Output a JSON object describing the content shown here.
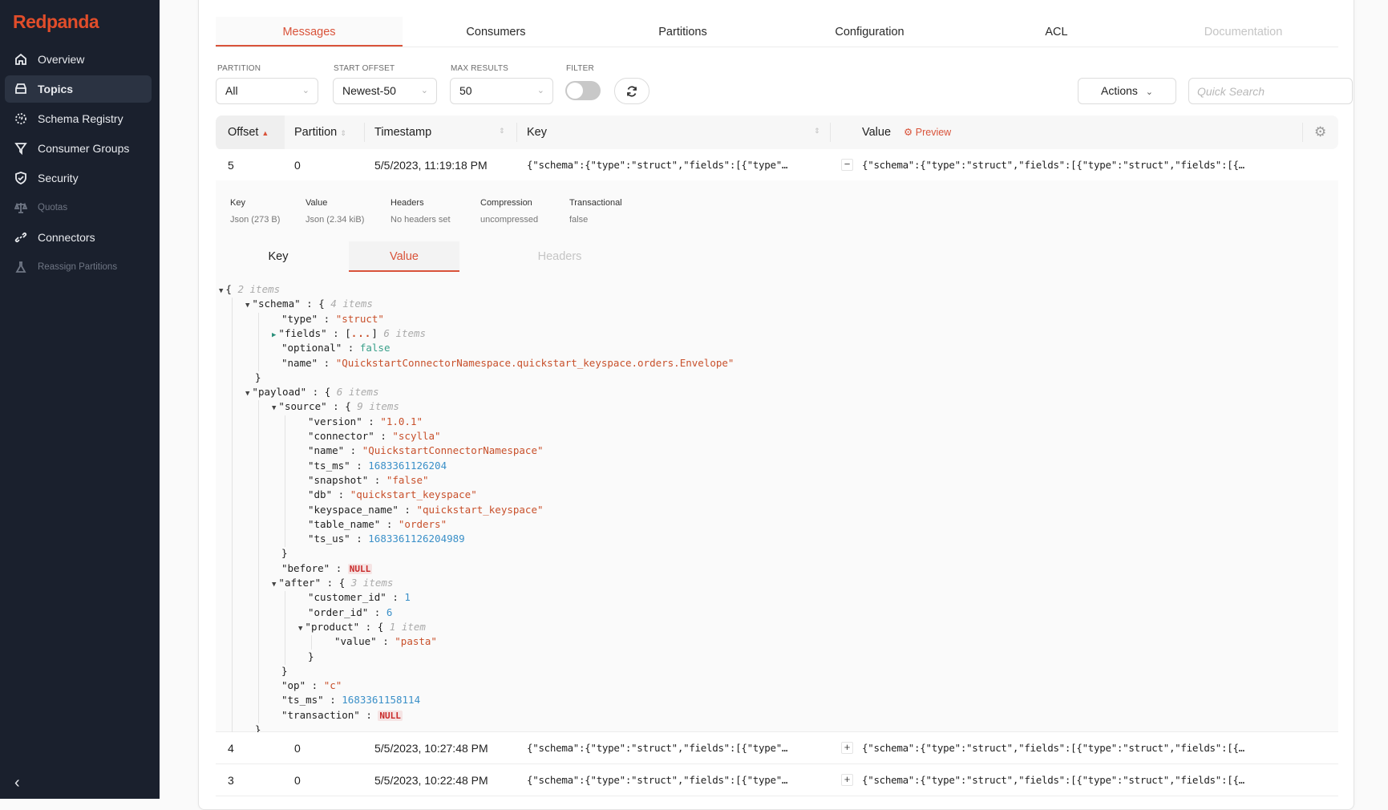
{
  "app": {
    "brand": "Redpanda"
  },
  "sidebar": {
    "items": [
      {
        "label": "Overview",
        "icon": "home-icon",
        "state": "normal"
      },
      {
        "label": "Topics",
        "icon": "topics-icon",
        "state": "active"
      },
      {
        "label": "Schema Registry",
        "icon": "schema-registry-icon",
        "state": "normal"
      },
      {
        "label": "Consumer Groups",
        "icon": "filter-funnel-icon",
        "state": "normal"
      },
      {
        "label": "Security",
        "icon": "shield-icon",
        "state": "normal"
      },
      {
        "label": "Quotas",
        "icon": "scale-icon",
        "state": "disabled"
      },
      {
        "label": "Connectors",
        "icon": "link-icon",
        "state": "normal"
      },
      {
        "label": "Reassign Partitions",
        "icon": "flask-icon",
        "state": "disabled"
      }
    ],
    "collapse_icon": "chevron-left-icon"
  },
  "tabs": [
    {
      "label": "Messages",
      "state": "active"
    },
    {
      "label": "Consumers",
      "state": "normal"
    },
    {
      "label": "Partitions",
      "state": "normal"
    },
    {
      "label": "Configuration",
      "state": "normal"
    },
    {
      "label": "ACL",
      "state": "normal"
    },
    {
      "label": "Documentation",
      "state": "disabled"
    }
  ],
  "filters": {
    "partition": {
      "label": "PARTITION",
      "value": "All"
    },
    "start_offset": {
      "label": "START OFFSET",
      "value": "Newest-50"
    },
    "max_results": {
      "label": "MAX RESULTS",
      "value": "50"
    },
    "filter": {
      "label": "FILTER",
      "enabled": false
    },
    "refresh_icon": "refresh-icon"
  },
  "actions": {
    "label": "Actions"
  },
  "search": {
    "placeholder": "Quick Search",
    "value": ""
  },
  "table": {
    "columns": {
      "offset": "Offset",
      "partition": "Partition",
      "timestamp": "Timestamp",
      "key": "Key",
      "value": "Value",
      "preview": "Preview"
    },
    "rows": [
      {
        "offset": "5",
        "partition": "0",
        "timestamp": "5/5/2023, 11:19:18 PM",
        "key": "{\"schema\":{\"type\":\"struct\",\"fields\":[{\"type\"…",
        "toggle": "−",
        "value": "{\"schema\":{\"type\":\"struct\",\"fields\":[{\"type\":\"struct\",\"fields\":[{…",
        "expanded": true
      },
      {
        "offset": "4",
        "partition": "0",
        "timestamp": "5/5/2023, 10:27:48 PM",
        "key": "{\"schema\":{\"type\":\"struct\",\"fields\":[{\"type\"…",
        "toggle": "+",
        "value": "{\"schema\":{\"type\":\"struct\",\"fields\":[{\"type\":\"struct\",\"fields\":[{…",
        "expanded": false
      },
      {
        "offset": "3",
        "partition": "0",
        "timestamp": "5/5/2023, 10:22:48 PM",
        "key": "{\"schema\":{\"type\":\"struct\",\"fields\":[{\"type\"…",
        "toggle": "+",
        "value": "{\"schema\":{\"type\":\"struct\",\"fields\":[{\"type\":\"struct\",\"fields\":[{…",
        "expanded": false
      }
    ]
  },
  "detail": {
    "meta": [
      {
        "label": "Key",
        "value": "Json (273 B)"
      },
      {
        "label": "Value",
        "value": "Json (2.34 kiB)"
      },
      {
        "label": "Headers",
        "value": "No headers set"
      },
      {
        "label": "Compression",
        "value": "uncompressed"
      },
      {
        "label": "Transactional",
        "value": "false"
      }
    ],
    "subtabs": [
      {
        "label": "Key",
        "state": "normal"
      },
      {
        "label": "Value",
        "state": "active"
      },
      {
        "label": "Headers",
        "state": "disabled"
      }
    ],
    "json_lines": [
      {
        "indent": 0,
        "toggle": "down",
        "key": "",
        "open": "{",
        "count": "2 items"
      },
      {
        "indent": 1,
        "toggle": "down",
        "key": "\"schema\"",
        "open": "{",
        "count": "4 items"
      },
      {
        "indent": 2,
        "key": "\"type\"",
        "value": "\"struct\"",
        "type": "s"
      },
      {
        "indent": 2,
        "toggle": "right",
        "key": "\"fields\"",
        "collapsed": "[...]",
        "count": "6 items"
      },
      {
        "indent": 2,
        "key": "\"optional\"",
        "value": "false",
        "type": "b"
      },
      {
        "indent": 2,
        "key": "\"name\"",
        "value": "\"QuickstartConnectorNamespace.quickstart_keyspace.orders.Envelope\"",
        "type": "s"
      },
      {
        "indent": 1,
        "close": "}"
      },
      {
        "indent": 1,
        "toggle": "down",
        "key": "\"payload\"",
        "open": "{",
        "count": "6 items"
      },
      {
        "indent": 2,
        "toggle": "down",
        "key": "\"source\"",
        "open": "{",
        "count": "9 items"
      },
      {
        "indent": 3,
        "key": "\"version\"",
        "value": "\"1.0.1\"",
        "type": "s"
      },
      {
        "indent": 3,
        "key": "\"connector\"",
        "value": "\"scylla\"",
        "type": "s"
      },
      {
        "indent": 3,
        "key": "\"name\"",
        "value": "\"QuickstartConnectorNamespace\"",
        "type": "s"
      },
      {
        "indent": 3,
        "key": "\"ts_ms\"",
        "value": "1683361126204",
        "type": "n"
      },
      {
        "indent": 3,
        "key": "\"snapshot\"",
        "value": "\"false\"",
        "type": "s"
      },
      {
        "indent": 3,
        "key": "\"db\"",
        "value": "\"quickstart_keyspace\"",
        "type": "s"
      },
      {
        "indent": 3,
        "key": "\"keyspace_name\"",
        "value": "\"quickstart_keyspace\"",
        "type": "s"
      },
      {
        "indent": 3,
        "key": "\"table_name\"",
        "value": "\"orders\"",
        "type": "s"
      },
      {
        "indent": 3,
        "key": "\"ts_us\"",
        "value": "1683361126204989",
        "type": "n"
      },
      {
        "indent": 2,
        "close": "}"
      },
      {
        "indent": 2,
        "key": "\"before\"",
        "value": "NULL",
        "type": "nul"
      },
      {
        "indent": 2,
        "toggle": "down",
        "key": "\"after\"",
        "open": "{",
        "count": "3 items"
      },
      {
        "indent": 3,
        "key": "\"customer_id\"",
        "value": "1",
        "type": "n"
      },
      {
        "indent": 3,
        "key": "\"order_id\"",
        "value": "6",
        "type": "n"
      },
      {
        "indent": 3,
        "toggle": "down",
        "key": "\"product\"",
        "open": "{",
        "count": "1 item"
      },
      {
        "indent": 4,
        "key": "\"value\"",
        "value": "\"pasta\"",
        "type": "s"
      },
      {
        "indent": 3,
        "close": "}"
      },
      {
        "indent": 2,
        "close": "}"
      },
      {
        "indent": 2,
        "key": "\"op\"",
        "value": "\"c\"",
        "type": "s"
      },
      {
        "indent": 2,
        "key": "\"ts_ms\"",
        "value": "1683361158114",
        "type": "n"
      },
      {
        "indent": 2,
        "key": "\"transaction\"",
        "value": "NULL",
        "type": "nul"
      },
      {
        "indent": 1,
        "close": "}"
      },
      {
        "indent": 0,
        "close": "}"
      }
    ]
  },
  "colors": {
    "accent": "#d9533a",
    "sidebar_bg": "#1a202d",
    "brand": "#e14d2a"
  }
}
